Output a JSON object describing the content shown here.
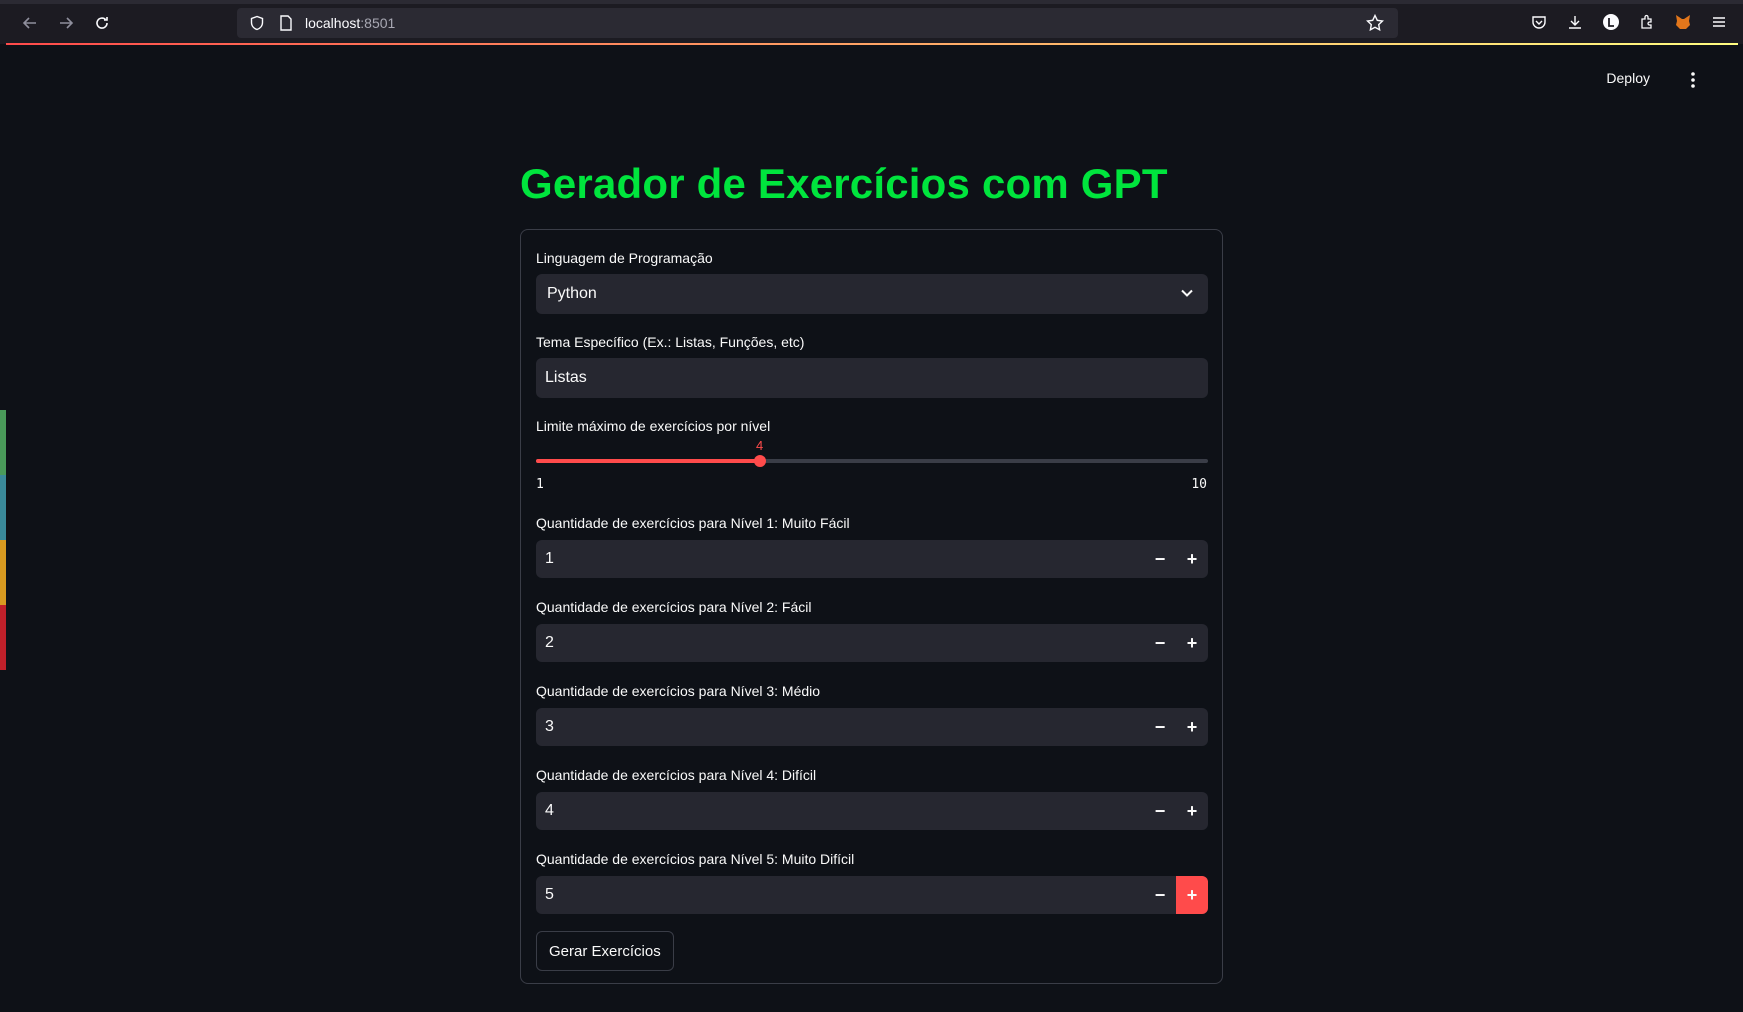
{
  "browser": {
    "url_host": "localhost",
    "url_port": ":8501"
  },
  "header": {
    "deploy_label": "Deploy"
  },
  "main": {
    "title": "Gerador de Exercícios com GPT",
    "language": {
      "label": "Linguagem de Programação",
      "selected": "Python"
    },
    "topic": {
      "label": "Tema Específico (Ex.: Listas, Funções, etc)",
      "value": "Listas"
    },
    "slider": {
      "label": "Limite máximo de exercícios por nível",
      "value": "4",
      "min": "1",
      "max": "10"
    },
    "levels": [
      {
        "label": "Quantidade de exercícios para Nível 1: Muito Fácil",
        "value": "1"
      },
      {
        "label": "Quantidade de exercícios para Nível 2: Fácil",
        "value": "2"
      },
      {
        "label": "Quantidade de exercícios para Nível 3: Médio",
        "value": "3"
      },
      {
        "label": "Quantidade de exercícios para Nível 4: Difícil",
        "value": "4"
      },
      {
        "label": "Quantidade de exercícios para Nível 5: Muito Difícil",
        "value": "5"
      }
    ],
    "submit_label": "Gerar Exercícios"
  },
  "colors": {
    "title": "#00e53d",
    "accent": "#ff4b4b",
    "background": "#0e1117",
    "input_bg": "#262730"
  }
}
